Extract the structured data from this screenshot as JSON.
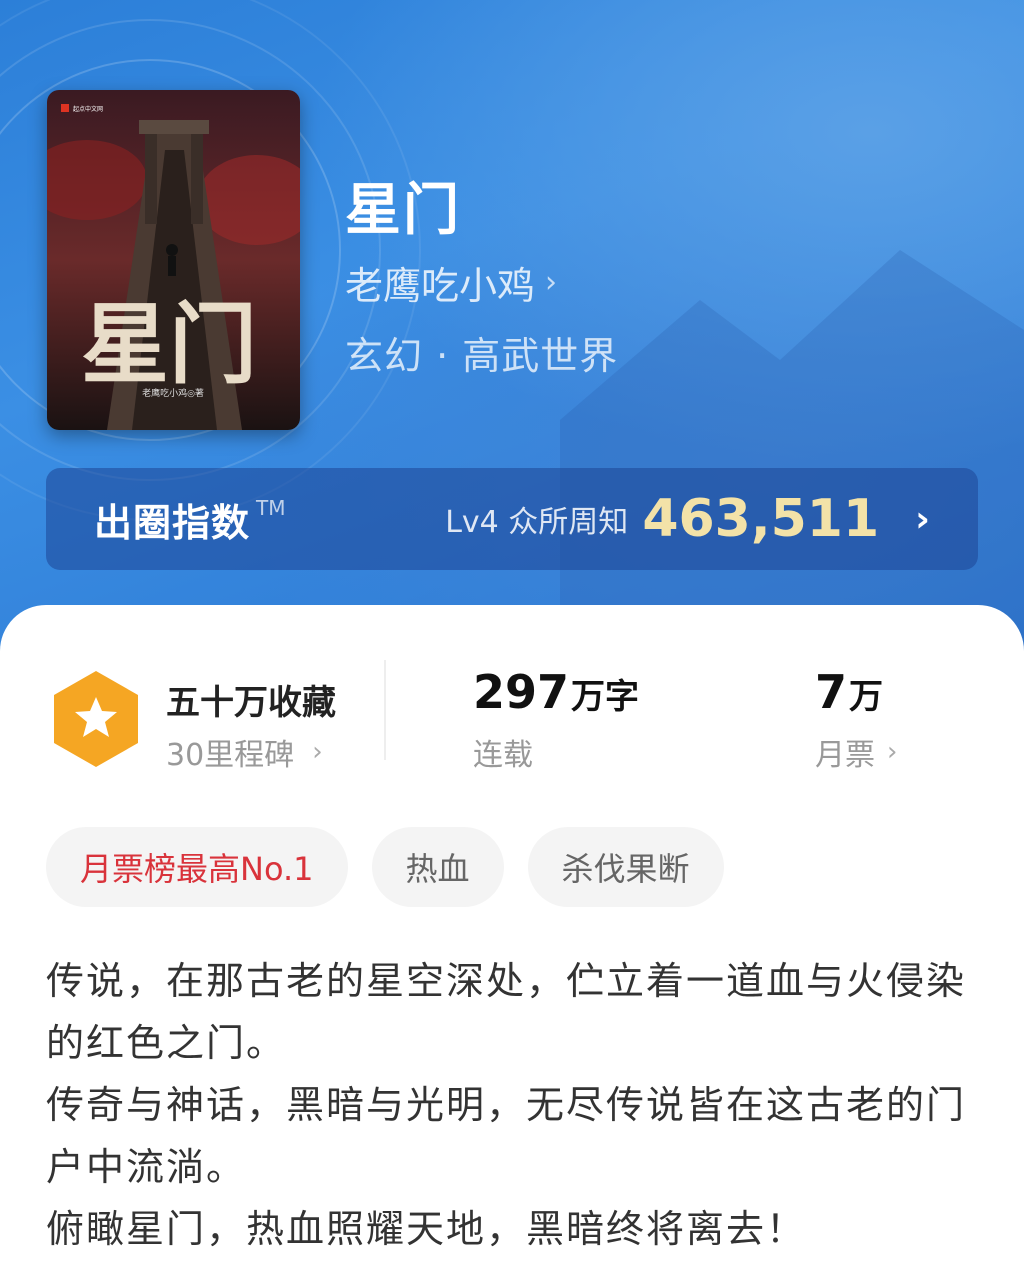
{
  "book": {
    "title": "星门",
    "author": "老鹰吃小鸡",
    "genre": "玄幻 · 高武世界",
    "cover": {
      "title_text": "星门",
      "author_text": "老鹰吃小鸡◎著",
      "publisher_text": "起点中文网"
    }
  },
  "index_bar": {
    "label": "出圈指数",
    "trademark": "TM",
    "level": "Lv4 众所周知",
    "value": "463,511"
  },
  "stats": {
    "collection": {
      "title": "五十万收藏",
      "sub": "30里程碑"
    },
    "words": {
      "number": "297",
      "unit": "万字",
      "sub": "连载"
    },
    "tickets": {
      "number": "7",
      "unit": "万",
      "sub": "月票"
    }
  },
  "tags": [
    {
      "label": "月票榜最高No.1"
    },
    {
      "label": "热血"
    },
    {
      "label": "杀伐果断"
    }
  ],
  "description": [
    "传说，在那古老的星空深处，伫立着一道血与火侵染的红色之门。",
    "传奇与神话，黑暗与光明，无尽传说皆在这古老的门户中流淌。",
    "俯瞰星门，热血照耀天地，黑暗终将离去！"
  ],
  "colors": {
    "hero_blue": "#2c7fd8",
    "index_value_gold": "#f3e2a8",
    "tag_hot_red": "#d9333b",
    "badge_orange": "#f5a623"
  }
}
